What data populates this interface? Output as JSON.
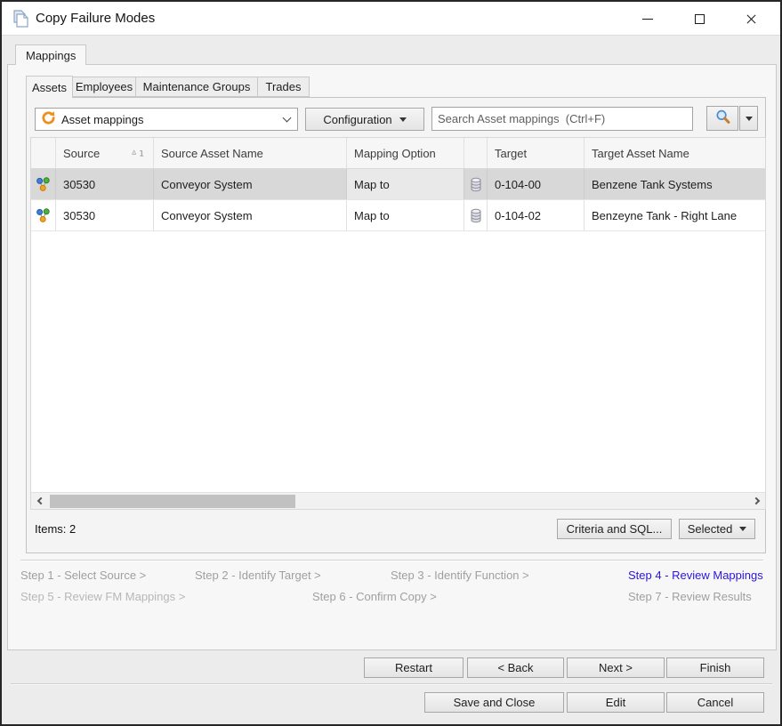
{
  "window": {
    "title": "Copy Failure Modes"
  },
  "tabs": {
    "outer_label": "Mappings",
    "inner": [
      "Assets",
      "Employees",
      "Maintenance Groups",
      "Trades"
    ]
  },
  "toolbar": {
    "mapping_selector_value": "Asset mappings",
    "configuration_label": "Configuration",
    "search_placeholder": "Search Asset mappings  (Ctrl+F)"
  },
  "grid": {
    "columns": {
      "source": "Source",
      "source_asset_name": "Source Asset Name",
      "mapping_option": "Mapping Option",
      "target": "Target",
      "target_asset_name": "Target Asset Name"
    },
    "sort_indicator": "1",
    "rows": [
      {
        "source": "30530",
        "source_asset_name": "Conveyor System",
        "mapping_option": "Map to",
        "target": "0-104-00",
        "target_asset_name": "Benzene Tank Systems"
      },
      {
        "source": "30530",
        "source_asset_name": "Conveyor System",
        "mapping_option": "Map to",
        "target": "0-104-02",
        "target_asset_name": "Benzeyne Tank - Right Lane"
      }
    ]
  },
  "status": {
    "items": "Items: 2"
  },
  "panel_actions": {
    "criteria_sql": "Criteria and SQL...",
    "selected": "Selected"
  },
  "steps": [
    {
      "label": "Step 1 - Select Source >"
    },
    {
      "label": "Step 2 - Identify Target >"
    },
    {
      "label": "Step 3 - Identify Function >"
    },
    {
      "label": "Step 4 - Review Mappings"
    },
    {
      "label": "Step 5 - Review FM Mappings >"
    },
    {
      "label": "Step 6 - Confirm Copy >"
    },
    {
      "label": "Step 7 - Review Results"
    }
  ],
  "wizard_buttons": {
    "restart": "Restart",
    "back": "< Back",
    "next": "Next >",
    "finish": "Finish"
  },
  "dialog_buttons": {
    "save_and_close": "Save and Close",
    "edit": "Edit",
    "cancel": "Cancel"
  },
  "colors": {
    "active_step_blue": "#2b16dd",
    "selected_row_gray": "#d8d8d8",
    "accent_orange": "#ee8f1c",
    "dialog_background": "#ececec"
  }
}
